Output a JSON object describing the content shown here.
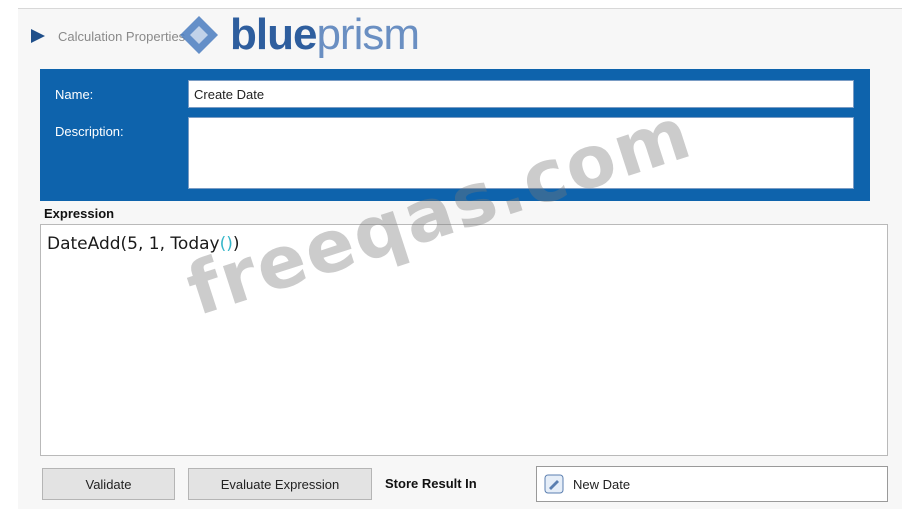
{
  "dialog": {
    "title": "Calculation Properties",
    "brand": {
      "strong": "blue",
      "light": "prism"
    }
  },
  "fields": {
    "name_label": "Name:",
    "name_value": "Create Date",
    "description_label": "Description:",
    "description_value": ""
  },
  "expression": {
    "label": "Expression",
    "func": "DateAdd(5, 1, Today",
    "open_paren": "(",
    "close_paren": ")",
    "tail": ")"
  },
  "actions": {
    "validate_label": "Validate",
    "evaluate_label": "Evaluate Expression",
    "store_label": "Store Result In",
    "store_value": "New Date"
  },
  "watermark": "freeqas.com",
  "colors": {
    "panel": "#0e63ac",
    "brand": "#2e5e9e",
    "paren": "#35b6c9"
  },
  "icons": {
    "stage": "calculation-stage-icon",
    "data": "data-item-icon",
    "logo": "blueprism-logo-mark"
  }
}
